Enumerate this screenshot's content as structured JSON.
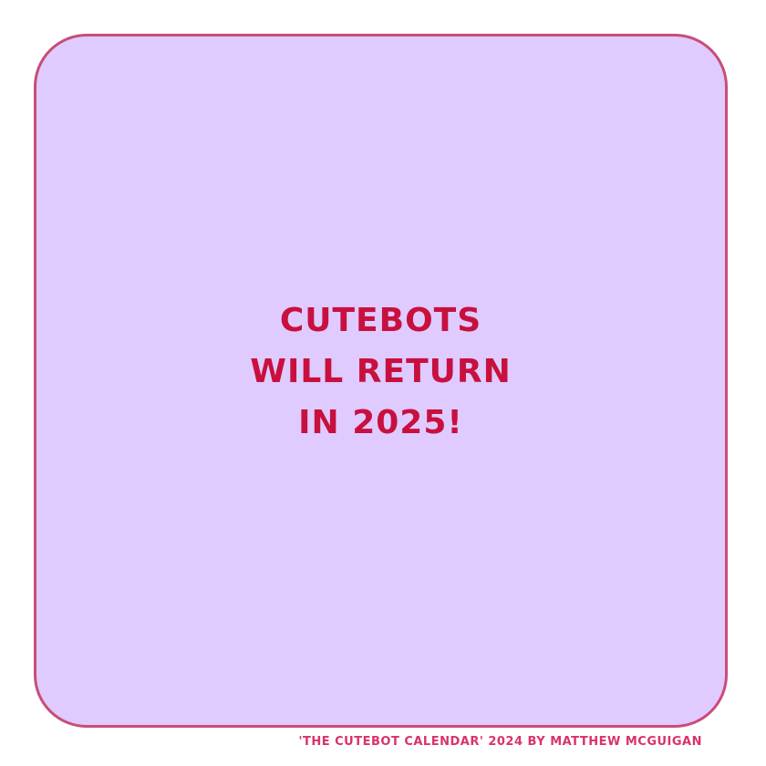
{
  "card": {
    "background_color": "#dfcbff",
    "border_color": "#c84d78",
    "message_lines": [
      "CUTEBOTS",
      "WILL RETURN",
      "IN 2025!"
    ],
    "message_color": "#c8103f"
  },
  "footer": {
    "credit": "'THE CUTEBOT CALENDAR' 2024 BY MATTHEW MCGUIGAN",
    "credit_color": "#d8336a"
  }
}
